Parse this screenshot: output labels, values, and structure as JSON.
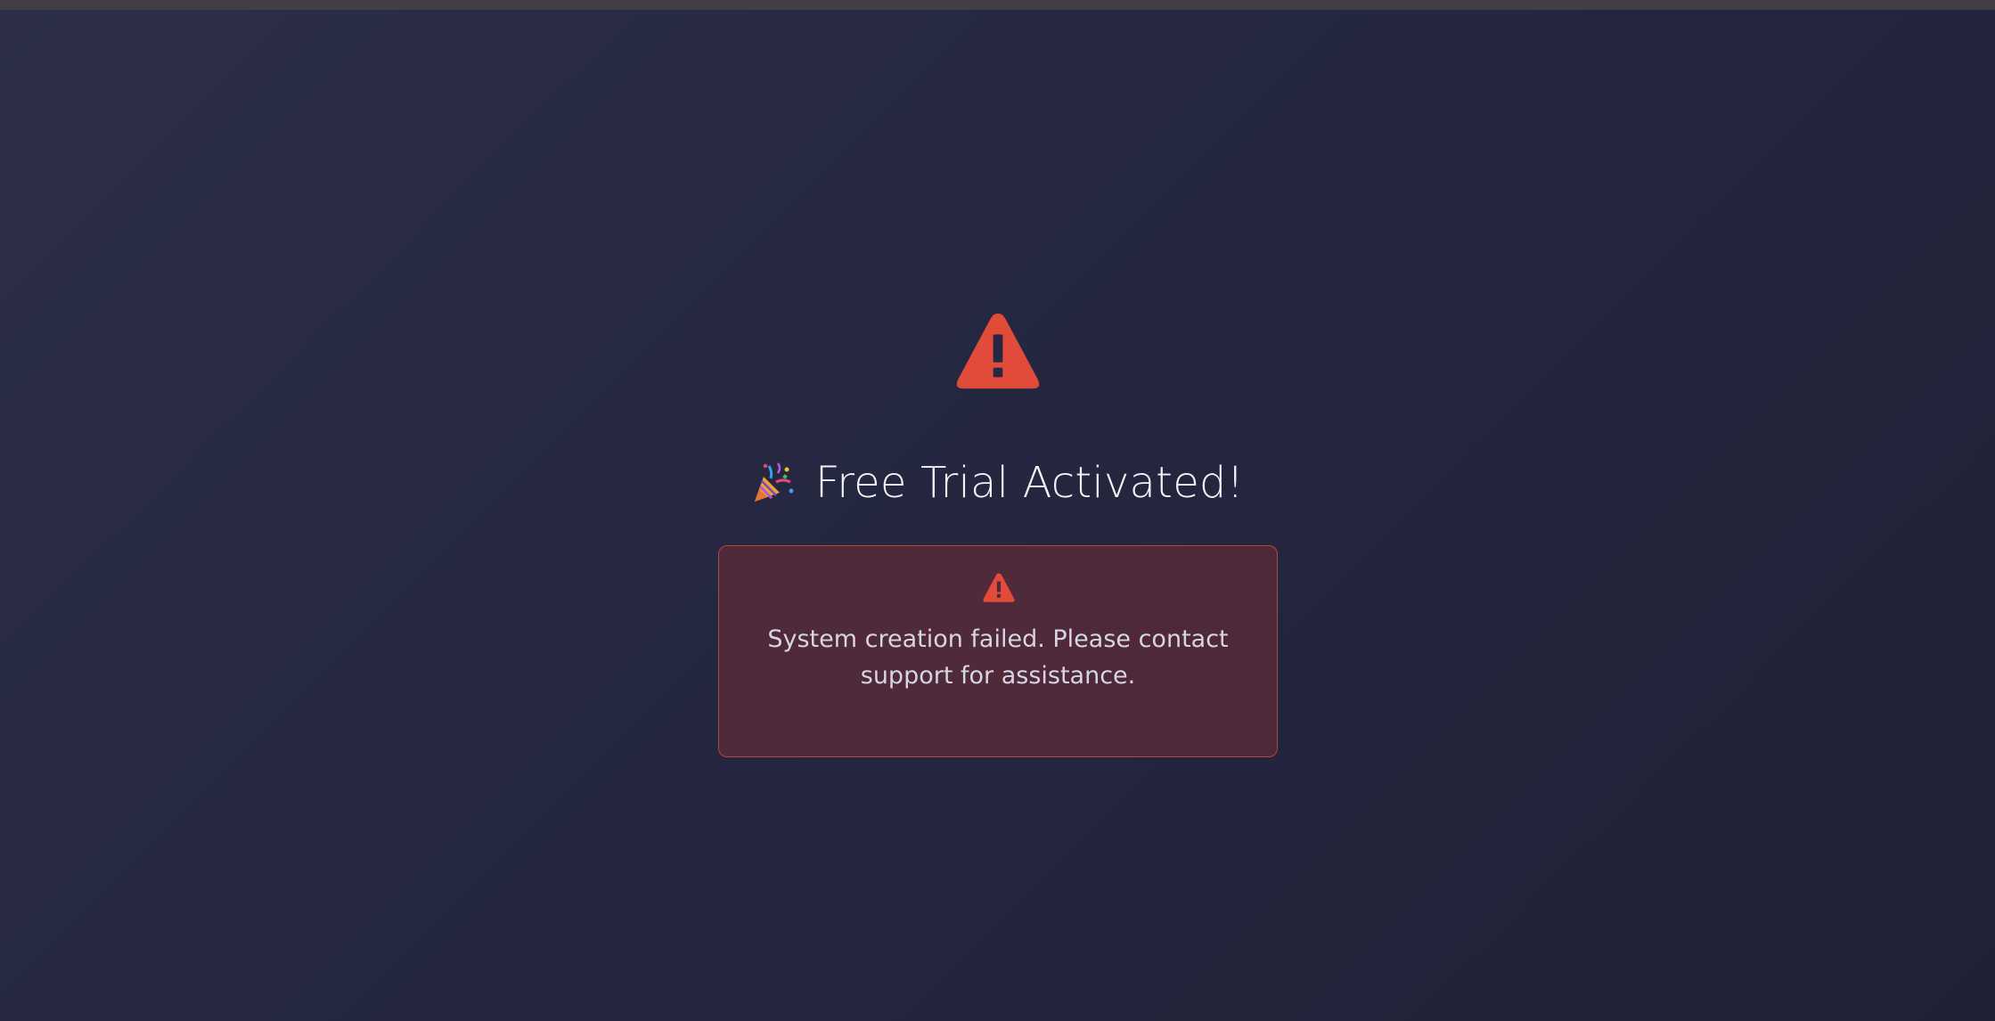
{
  "page": {
    "heading_emoji_icon": "party-popper-icon",
    "heading": "Free Trial Activated!",
    "status_icon": "warning-triangle-icon"
  },
  "error": {
    "icon": "warning-triangle-icon",
    "message": "System creation failed. Please contact support for assistance."
  },
  "colors": {
    "background_start": "#2d2f48",
    "background_end": "#1f2136",
    "accent_red": "#e04b3a",
    "card_border": "#b9433d",
    "card_fill": "#4a2b3a",
    "heading_text": "#f2f3f8",
    "body_text": "#d5d6e4"
  }
}
